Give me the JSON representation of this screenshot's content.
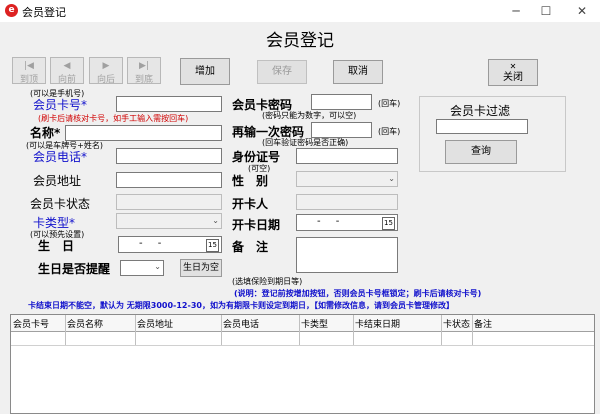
{
  "window": {
    "title": "会员登记",
    "minimize": "─",
    "maximize": "☐",
    "close": "✕"
  },
  "form_title": "会员登记",
  "nav": [
    {
      "label": "到顶",
      "icon": "|◀"
    },
    {
      "label": "向前",
      "icon": "◀"
    },
    {
      "label": "向后",
      "icon": "▶"
    },
    {
      "label": "到底",
      "icon": "▶|"
    }
  ],
  "buttons": {
    "add": "增加",
    "save": "保存",
    "cancel": "取消",
    "close": "关闭",
    "query": "查询",
    "birthday_empty": "生日为空"
  },
  "hints": {
    "card_phone": "(可以是手机号)",
    "swipe": "(刷卡后请核对卡号，如手工输入需按回车)",
    "plate_name": "(可以是车牌号+姓名)",
    "preset": "(可以预先设置)",
    "password_note": "(密码只能为数字，可以空)",
    "enter1": "(回车)",
    "enter2": "(回车)",
    "pwd_verify": "(回车验证密码是否正确)",
    "can_empty": "(可空)",
    "insurance": "(选填保险到期日等)",
    "note1": "(说明：登记前按增加按钮，否则会员卡号框锁定；刷卡后请核对卡号)",
    "note2": "卡结束日期不能空，默认为 无期限3000-12-30，如为有期限卡则设定到期日，【如需修改信息，请到会员卡管理修改】"
  },
  "labels": {
    "card_no": "会员卡号*",
    "name": "名称*",
    "phone": "会员电话*",
    "address": "会员地址",
    "status": "会员卡状态",
    "card_type": "卡类型*",
    "birthday": "生　日",
    "bday_remind": "生日是否提醒",
    "password": "会员卡密码",
    "password2": "再输一次密码",
    "id_no": "身份证号",
    "gender": "性　别",
    "opener": "开卡人",
    "open_date": "开卡日期",
    "remark": "备　注",
    "filter": "会员卡过滤"
  },
  "dates": {
    "birthday": "- -",
    "open_date": "- -"
  },
  "table": {
    "headers": [
      "会员卡号",
      "会员名称",
      "会员地址",
      "会员电话",
      "卡类型",
      "卡结束日期",
      "卡状态",
      "备注"
    ]
  }
}
